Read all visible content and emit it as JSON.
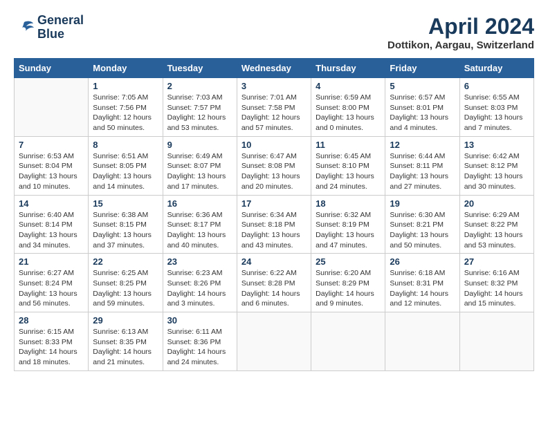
{
  "header": {
    "logo_line1": "General",
    "logo_line2": "Blue",
    "month": "April 2024",
    "location": "Dottikon, Aargau, Switzerland"
  },
  "days_of_week": [
    "Sunday",
    "Monday",
    "Tuesday",
    "Wednesday",
    "Thursday",
    "Friday",
    "Saturday"
  ],
  "weeks": [
    [
      {
        "day": "",
        "info": ""
      },
      {
        "day": "1",
        "info": "Sunrise: 7:05 AM\nSunset: 7:56 PM\nDaylight: 12 hours\nand 50 minutes."
      },
      {
        "day": "2",
        "info": "Sunrise: 7:03 AM\nSunset: 7:57 PM\nDaylight: 12 hours\nand 53 minutes."
      },
      {
        "day": "3",
        "info": "Sunrise: 7:01 AM\nSunset: 7:58 PM\nDaylight: 12 hours\nand 57 minutes."
      },
      {
        "day": "4",
        "info": "Sunrise: 6:59 AM\nSunset: 8:00 PM\nDaylight: 13 hours\nand 0 minutes."
      },
      {
        "day": "5",
        "info": "Sunrise: 6:57 AM\nSunset: 8:01 PM\nDaylight: 13 hours\nand 4 minutes."
      },
      {
        "day": "6",
        "info": "Sunrise: 6:55 AM\nSunset: 8:03 PM\nDaylight: 13 hours\nand 7 minutes."
      }
    ],
    [
      {
        "day": "7",
        "info": "Sunrise: 6:53 AM\nSunset: 8:04 PM\nDaylight: 13 hours\nand 10 minutes."
      },
      {
        "day": "8",
        "info": "Sunrise: 6:51 AM\nSunset: 8:05 PM\nDaylight: 13 hours\nand 14 minutes."
      },
      {
        "day": "9",
        "info": "Sunrise: 6:49 AM\nSunset: 8:07 PM\nDaylight: 13 hours\nand 17 minutes."
      },
      {
        "day": "10",
        "info": "Sunrise: 6:47 AM\nSunset: 8:08 PM\nDaylight: 13 hours\nand 20 minutes."
      },
      {
        "day": "11",
        "info": "Sunrise: 6:45 AM\nSunset: 8:10 PM\nDaylight: 13 hours\nand 24 minutes."
      },
      {
        "day": "12",
        "info": "Sunrise: 6:44 AM\nSunset: 8:11 PM\nDaylight: 13 hours\nand 27 minutes."
      },
      {
        "day": "13",
        "info": "Sunrise: 6:42 AM\nSunset: 8:12 PM\nDaylight: 13 hours\nand 30 minutes."
      }
    ],
    [
      {
        "day": "14",
        "info": "Sunrise: 6:40 AM\nSunset: 8:14 PM\nDaylight: 13 hours\nand 34 minutes."
      },
      {
        "day": "15",
        "info": "Sunrise: 6:38 AM\nSunset: 8:15 PM\nDaylight: 13 hours\nand 37 minutes."
      },
      {
        "day": "16",
        "info": "Sunrise: 6:36 AM\nSunset: 8:17 PM\nDaylight: 13 hours\nand 40 minutes."
      },
      {
        "day": "17",
        "info": "Sunrise: 6:34 AM\nSunset: 8:18 PM\nDaylight: 13 hours\nand 43 minutes."
      },
      {
        "day": "18",
        "info": "Sunrise: 6:32 AM\nSunset: 8:19 PM\nDaylight: 13 hours\nand 47 minutes."
      },
      {
        "day": "19",
        "info": "Sunrise: 6:30 AM\nSunset: 8:21 PM\nDaylight: 13 hours\nand 50 minutes."
      },
      {
        "day": "20",
        "info": "Sunrise: 6:29 AM\nSunset: 8:22 PM\nDaylight: 13 hours\nand 53 minutes."
      }
    ],
    [
      {
        "day": "21",
        "info": "Sunrise: 6:27 AM\nSunset: 8:24 PM\nDaylight: 13 hours\nand 56 minutes."
      },
      {
        "day": "22",
        "info": "Sunrise: 6:25 AM\nSunset: 8:25 PM\nDaylight: 13 hours\nand 59 minutes."
      },
      {
        "day": "23",
        "info": "Sunrise: 6:23 AM\nSunset: 8:26 PM\nDaylight: 14 hours\nand 3 minutes."
      },
      {
        "day": "24",
        "info": "Sunrise: 6:22 AM\nSunset: 8:28 PM\nDaylight: 14 hours\nand 6 minutes."
      },
      {
        "day": "25",
        "info": "Sunrise: 6:20 AM\nSunset: 8:29 PM\nDaylight: 14 hours\nand 9 minutes."
      },
      {
        "day": "26",
        "info": "Sunrise: 6:18 AM\nSunset: 8:31 PM\nDaylight: 14 hours\nand 12 minutes."
      },
      {
        "day": "27",
        "info": "Sunrise: 6:16 AM\nSunset: 8:32 PM\nDaylight: 14 hours\nand 15 minutes."
      }
    ],
    [
      {
        "day": "28",
        "info": "Sunrise: 6:15 AM\nSunset: 8:33 PM\nDaylight: 14 hours\nand 18 minutes."
      },
      {
        "day": "29",
        "info": "Sunrise: 6:13 AM\nSunset: 8:35 PM\nDaylight: 14 hours\nand 21 minutes."
      },
      {
        "day": "30",
        "info": "Sunrise: 6:11 AM\nSunset: 8:36 PM\nDaylight: 14 hours\nand 24 minutes."
      },
      {
        "day": "",
        "info": ""
      },
      {
        "day": "",
        "info": ""
      },
      {
        "day": "",
        "info": ""
      },
      {
        "day": "",
        "info": ""
      }
    ]
  ]
}
